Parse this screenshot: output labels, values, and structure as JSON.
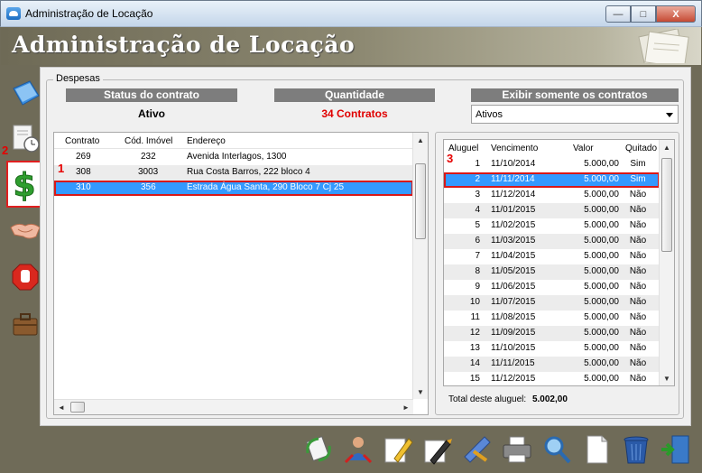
{
  "window": {
    "title": "Administração de Locação",
    "min": "—",
    "max": "□",
    "close": "X"
  },
  "header": {
    "title": "Administração de Locação"
  },
  "nav": {
    "marker_2": "2",
    "marker_1": "1",
    "marker_3": "3"
  },
  "group": {
    "label": "Despesas"
  },
  "status": {
    "header": "Status do contrato",
    "value": "Ativo"
  },
  "quantity": {
    "header": "Quantidade",
    "value": "34 Contratos"
  },
  "filter": {
    "header": "Exibir somente os contratos",
    "selected": "Ativos"
  },
  "contracts": {
    "columns": [
      "Contrato",
      "Cód. Imóvel",
      "Endereço"
    ],
    "rows": [
      [
        "269",
        "232",
        "Avenida Interlagos, 1300"
      ],
      [
        "308",
        "3003",
        "Rua Costa Barros, 222 bloco 4"
      ],
      [
        "310",
        "356",
        "Estrada Água Santa, 290 Bloco 7 Cj 25"
      ]
    ]
  },
  "rents": {
    "columns": [
      "Aluguel",
      "Vencimento",
      "Valor",
      "Quitado"
    ],
    "rows": [
      [
        "1",
        "11/10/2014",
        "5.000,00",
        "Sim"
      ],
      [
        "2",
        "11/11/2014",
        "5.000,00",
        "Sim"
      ],
      [
        "3",
        "11/12/2014",
        "5.000,00",
        "Não"
      ],
      [
        "4",
        "11/01/2015",
        "5.000,00",
        "Não"
      ],
      [
        "5",
        "11/02/2015",
        "5.000,00",
        "Não"
      ],
      [
        "6",
        "11/03/2015",
        "5.000,00",
        "Não"
      ],
      [
        "7",
        "11/04/2015",
        "5.000,00",
        "Não"
      ],
      [
        "8",
        "11/05/2015",
        "5.000,00",
        "Não"
      ],
      [
        "9",
        "11/06/2015",
        "5.000,00",
        "Não"
      ],
      [
        "10",
        "11/07/2015",
        "5.000,00",
        "Não"
      ],
      [
        "11",
        "11/08/2015",
        "5.000,00",
        "Não"
      ],
      [
        "12",
        "11/09/2015",
        "5.000,00",
        "Não"
      ],
      [
        "13",
        "11/10/2015",
        "5.000,00",
        "Não"
      ],
      [
        "14",
        "11/11/2015",
        "5.000,00",
        "Não"
      ],
      [
        "15",
        "11/12/2015",
        "5.000,00",
        "Não"
      ]
    ],
    "total_label": "Total deste aluguel:",
    "total_value": "5.002,00"
  },
  "colors": {
    "accent": "#3399ff",
    "highlight": "#d81818",
    "panel": "#f0f0f0",
    "chrome": "#6f6b58"
  },
  "icons": {
    "nav": [
      "notebook-icon",
      "calendar-clock-icon",
      "dollar-icon",
      "handshake-icon",
      "stop-hand-icon",
      "briefcase-icon"
    ],
    "toolbar": [
      "refresh-docs-icon",
      "users-icon",
      "pencil-edit-icon",
      "pen-sign-icon",
      "ruler-pencil-icon",
      "printer-icon",
      "magnifier-icon",
      "new-document-icon",
      "trash-icon",
      "exit-door-icon"
    ]
  }
}
